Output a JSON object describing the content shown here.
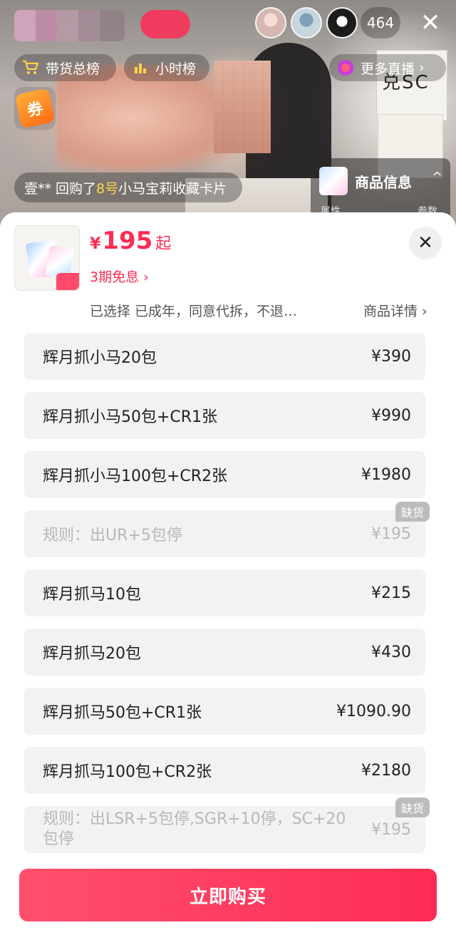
{
  "stream": {
    "viewer_count": "464",
    "sign_text": "兑SC",
    "chips": {
      "rank_label": "带货总榜",
      "hour_label": "小时榜",
      "more_live_label": "更多直播"
    },
    "coupon_label": "券",
    "repurchase": {
      "prefix": "壹** 回购了",
      "highlight": "8号",
      "suffix": "小马宝莉收藏卡片"
    },
    "product_info": {
      "title": "商品信息",
      "sub_left": "属性",
      "sub_right": "参数"
    }
  },
  "sheet": {
    "currency": "¥",
    "price": "195",
    "price_suffix": "起",
    "installment": "3期免息 ›",
    "selected": "已选择  已成年，同意代拆，不退…",
    "details_link": "商品详情 ›",
    "options": [
      {
        "label": "辉月抓小马20包",
        "price": "¥390",
        "disabled": false
      },
      {
        "label": "辉月抓小马50包+CR1张",
        "price": "¥990",
        "disabled": false
      },
      {
        "label": "辉月抓小马100包+CR2张",
        "price": "¥1980",
        "disabled": false
      },
      {
        "label": "规则：出UR+5包停",
        "price": "¥195",
        "disabled": true,
        "badge": "缺货"
      },
      {
        "label": "辉月抓马10包",
        "price": "¥215",
        "disabled": false
      },
      {
        "label": "辉月抓马20包",
        "price": "¥430",
        "disabled": false
      },
      {
        "label": "辉月抓马50包+CR1张",
        "price": "¥1090.90",
        "disabled": false
      },
      {
        "label": "辉月抓马100包+CR2张",
        "price": "¥2180",
        "disabled": false
      },
      {
        "label": "规则：出LSR+5包停,SGR+10停，SC+20包停",
        "price": "¥195",
        "disabled": true,
        "badge": "缺货"
      }
    ],
    "buy_button": "立即购买"
  },
  "colors": {
    "accent": "#fe2c55",
    "option_bg": "#f2f2f2",
    "disabled_text": "#b8b8b8",
    "badge_bg": "#bcbcbc",
    "highlight_yellow": "#ffd44a"
  }
}
